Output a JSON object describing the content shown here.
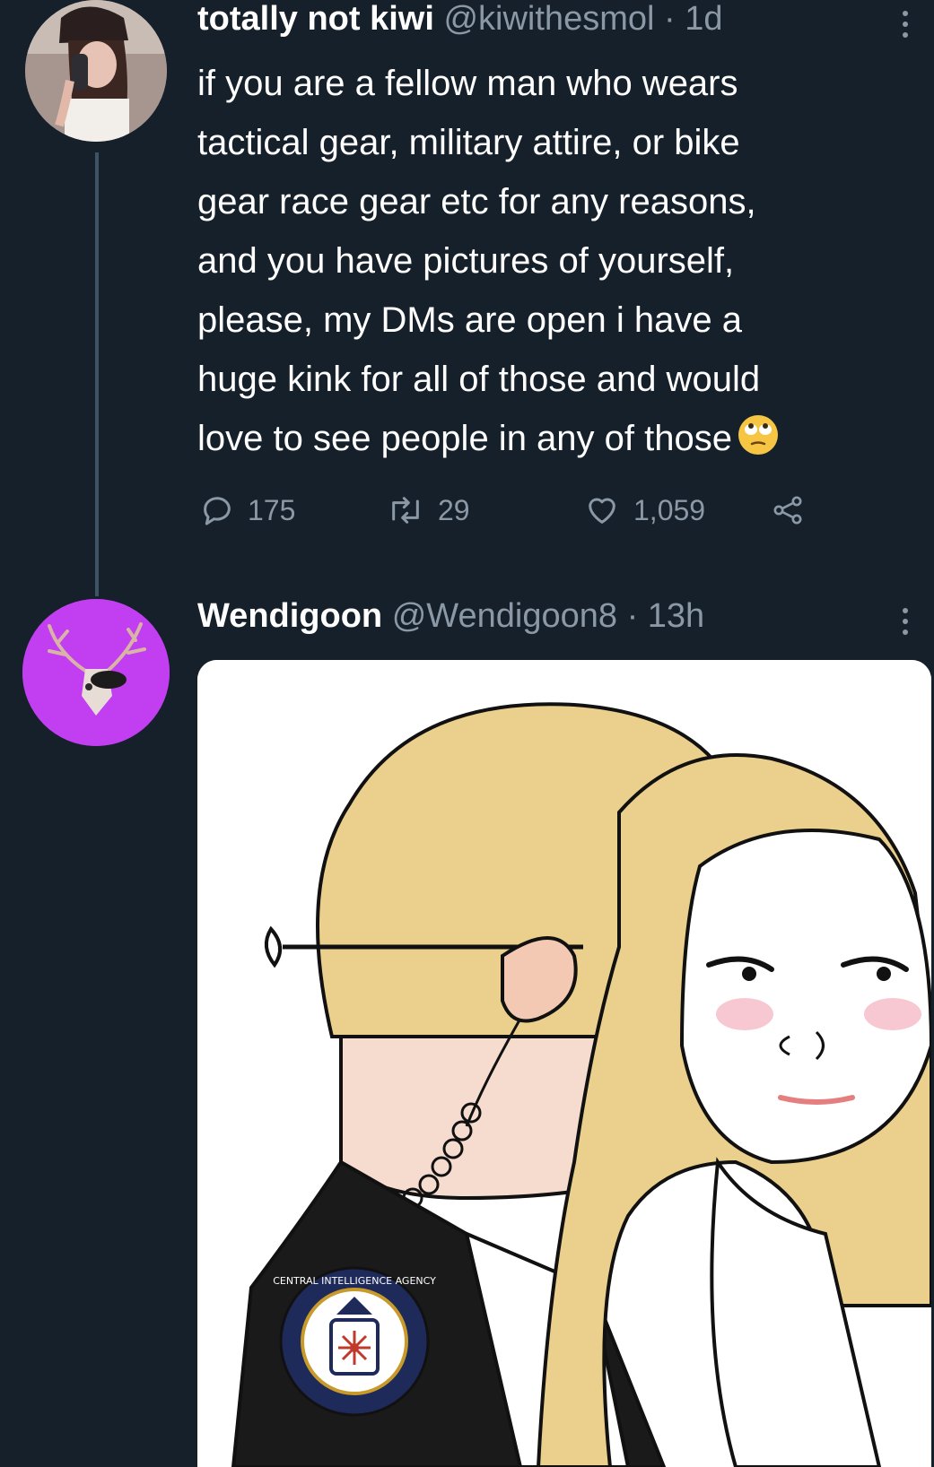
{
  "tweets": [
    {
      "name": "totally not kiwi",
      "handle": "@kiwithesmol",
      "time": "· 1d",
      "text_lines": [
        "if you are a fellow man who wears",
        "tactical gear, military attire, or bike",
        "gear race gear etc for any reasons,",
        "and you have pictures of yourself,",
        "please, my DMs are open i have a",
        "huge kink for all of those and would",
        "love to see people in any of those"
      ],
      "emoji": "rolling-eyes-emoji",
      "stats": {
        "replies": "175",
        "retweets": "29",
        "likes": "1,059"
      }
    },
    {
      "name": "Wendigoon",
      "handle": "@Wendigoon8",
      "time": "· 13h",
      "media": {
        "seal_ring_text": "CENTRAL INTELLIGENCE AGENCY"
      }
    }
  ],
  "colors": {
    "background": "#15202b",
    "text": "#ffffff",
    "secondary": "#8b98a5",
    "wendigoon_avatar": "#c13ff0"
  },
  "icons": [
    "reply-icon",
    "retweet-icon",
    "like-icon",
    "share-icon",
    "more-icon"
  ]
}
